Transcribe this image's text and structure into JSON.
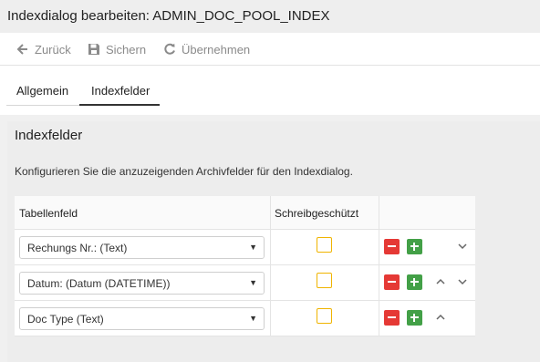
{
  "window": {
    "title": "Indexdialog bearbeiten: ADMIN_DOC_POOL_INDEX"
  },
  "toolbar": {
    "back_label": "Zurück",
    "save_label": "Sichern",
    "apply_label": "Übernehmen"
  },
  "tabs": [
    {
      "label": "Allgemein",
      "active": false
    },
    {
      "label": "Indexfelder",
      "active": true
    }
  ],
  "section": {
    "title": "Indexfelder",
    "description": "Konfigurieren Sie die anzuzeigenden Archivfelder für den Indexdialog."
  },
  "table": {
    "headers": {
      "field": "Tabellenfeld",
      "readonly": "Schreibgeschützt"
    },
    "rows": [
      {
        "field": "Rechungs Nr.: (Text)",
        "readonly": false
      },
      {
        "field": "Datum: (Datum (DATETIME))",
        "readonly": false
      },
      {
        "field": "Doc Type (Text)",
        "readonly": false
      }
    ]
  },
  "colors": {
    "remove": "#e53935",
    "add": "#43a047",
    "checkbox_border": "#f0b400"
  }
}
